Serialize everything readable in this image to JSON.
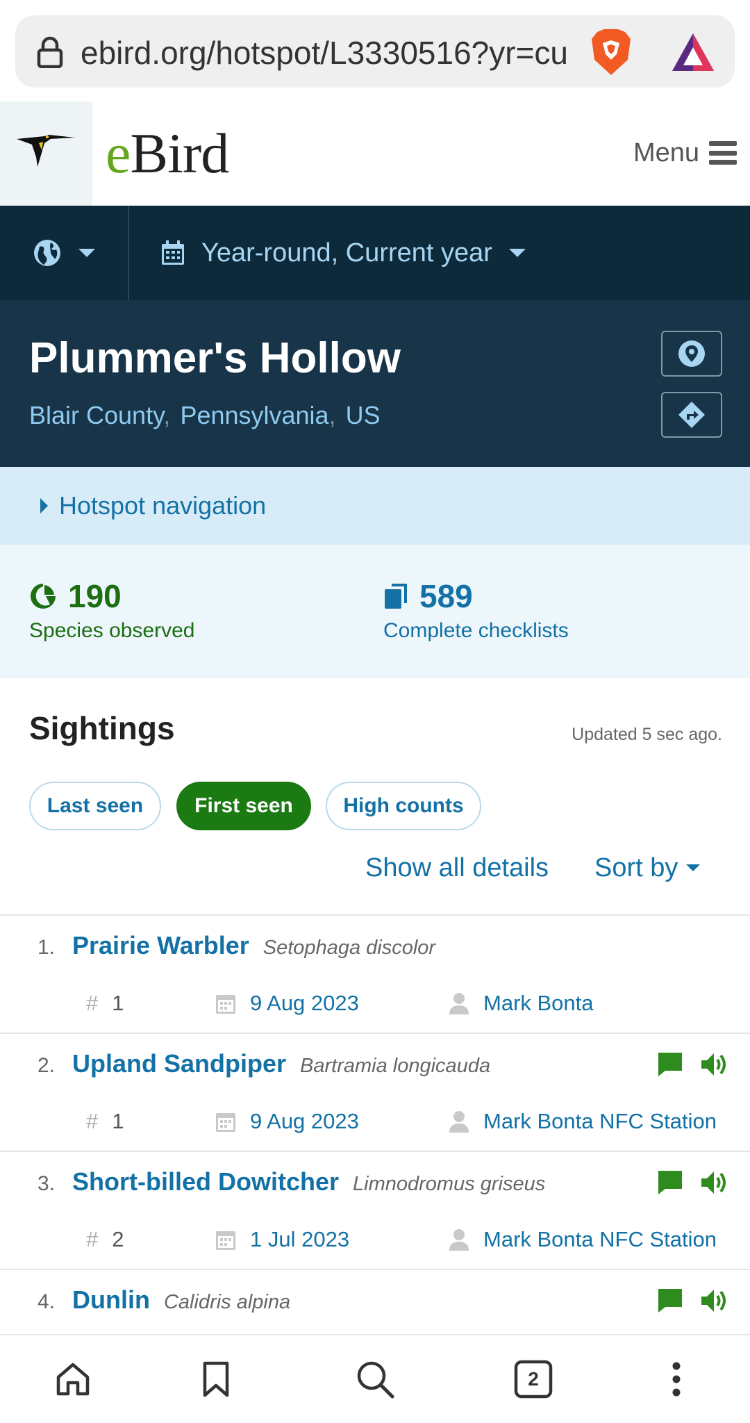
{
  "browser": {
    "url": "ebird.org/hotspot/L3330516?yr=cu"
  },
  "header": {
    "logo_prefix": "e",
    "logo_rest": "Bird",
    "menu_label": "Menu"
  },
  "filters": {
    "date_label": "Year-round, Current year"
  },
  "hotspot": {
    "name": "Plummer's Hollow",
    "county": "Blair County",
    "state": "Pennsylvania",
    "country": "US",
    "nav_label": "Hotspot navigation"
  },
  "stats": {
    "species_count": "190",
    "species_label": "Species observed",
    "checklists_count": "589",
    "checklists_label": "Complete checklists"
  },
  "sightings": {
    "title": "Sightings",
    "updated": "Updated 5 sec ago.",
    "tabs": [
      "Last seen",
      "First seen",
      "High counts"
    ],
    "active_tab": "First seen",
    "show_all": "Show all details",
    "sort_by": "Sort by",
    "items": [
      {
        "num": "1.",
        "common": "Prairie Warbler",
        "sci": "Setophaga discolor",
        "count": "1",
        "date": "9 Aug 2023",
        "observer": "Mark Bonta",
        "has_media": false
      },
      {
        "num": "2.",
        "common": "Upland Sandpiper",
        "sci": "Bartramia longicauda",
        "count": "1",
        "date": "9 Aug 2023",
        "observer": "Mark Bonta NFC Station",
        "has_media": true
      },
      {
        "num": "3.",
        "common": "Short-billed Dowitcher",
        "sci": "Limnodromus griseus",
        "count": "2",
        "date": "1 Jul 2023",
        "observer": "Mark Bonta NFC Station",
        "has_media": true
      },
      {
        "num": "4.",
        "common": "Dunlin",
        "sci": "Calidris alpina",
        "has_media": true
      }
    ]
  },
  "bottom_nav": {
    "tab_count": "2",
    "icons": [
      "home-icon",
      "bookmark-icon",
      "search-icon",
      "tabs-icon",
      "more-icon"
    ]
  },
  "colors": {
    "brand_green": "#66a61e",
    "link_blue": "#1371a6",
    "active_pill": "#1b7a12",
    "dark_nav": "#0d2a3b",
    "hero_bg": "#173448"
  }
}
